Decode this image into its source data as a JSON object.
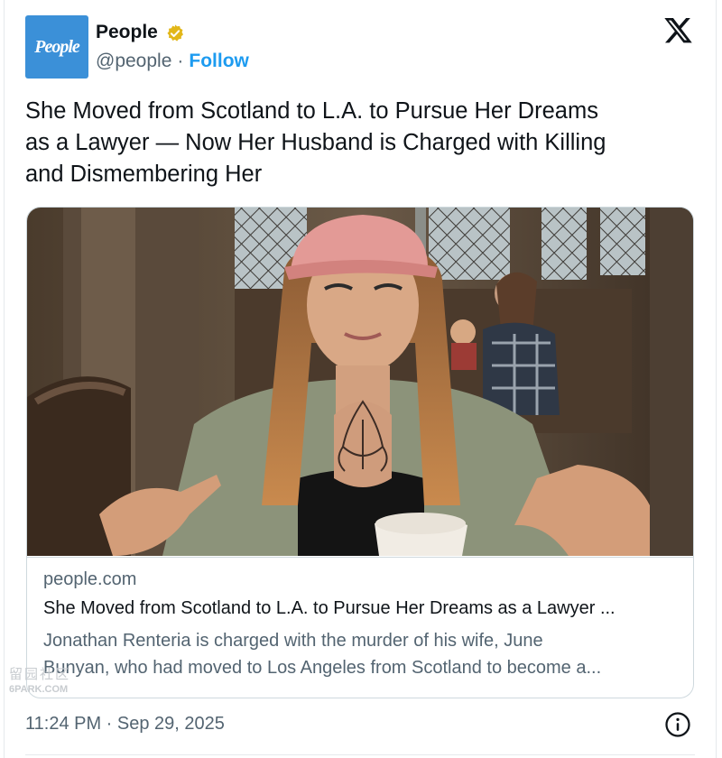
{
  "author": {
    "avatar_text": "People",
    "name": "People",
    "verified_icon": "verified-badge-gold",
    "handle": "@people",
    "separator": "·",
    "follow_label": "Follow"
  },
  "platform_logo": "x-logo",
  "tweet": {
    "text_line1": "She Moved from Scotland to L.A. to Pursue Her Dreams",
    "text_line2": "as a Lawyer — Now Her Husband is Charged with Killing",
    "text_line3": "and Dismembering Her"
  },
  "link_card": {
    "image": "photo-woman-pink-cap-pointing-at-tattoo",
    "domain": "people.com",
    "title": "She Moved from Scotland to L.A. to Pursue Her Dreams as a Lawyer ...",
    "description_line1": "Jonathan Renteria is charged with the murder of his wife, June",
    "description_line2": "Bunyan, who had moved to Los Angeles from Scotland to become a..."
  },
  "watermark": {
    "top": "留园社区",
    "bottom": "6PARK.COM"
  },
  "footer": {
    "timestamp": "11:24 PM · Sep 29, 2025",
    "info_icon": "info-icon"
  },
  "colors": {
    "accent": "#1d9bf0",
    "secondary_text": "#536471",
    "verified_gold": "#e2b719",
    "avatar_blue": "#3b90d8"
  }
}
